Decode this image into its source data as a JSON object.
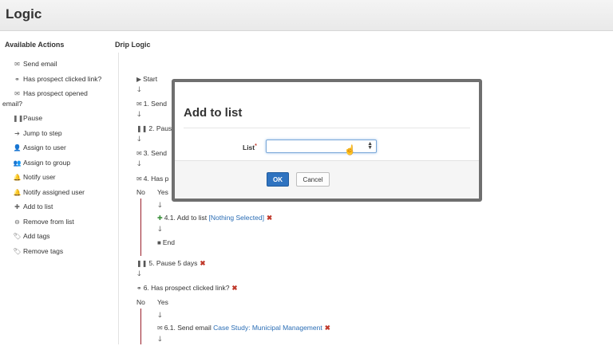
{
  "header": {
    "title": "Logic"
  },
  "available_actions": {
    "title": "Available Actions",
    "items": [
      {
        "label": "Send email",
        "icon": "envelope-icon",
        "glyph": "✉"
      },
      {
        "label": "Has prospect clicked link?",
        "icon": "link-icon",
        "glyph": "⚭"
      },
      {
        "label": "Has prospect opened",
        "label2": "email?",
        "icon": "envelope-open-icon",
        "glyph": "✉"
      },
      {
        "label": "Pause",
        "icon": "pause-icon",
        "glyph": "❚❚"
      },
      {
        "label": "Jump to step",
        "icon": "arrow-right-icon",
        "glyph": "➔"
      },
      {
        "label": "Assign to user",
        "icon": "user-icon",
        "glyph": "👤"
      },
      {
        "label": "Assign to group",
        "icon": "group-icon",
        "glyph": "👥"
      },
      {
        "label": "Notify user",
        "icon": "bell-icon",
        "glyph": "🔔"
      },
      {
        "label": "Notify assigned user",
        "icon": "bell-icon",
        "glyph": "🔔"
      },
      {
        "label": "Add to list",
        "icon": "plus-circle-icon",
        "glyph": "✚"
      },
      {
        "label": "Remove from list",
        "icon": "minus-circle-icon",
        "glyph": "⊖"
      },
      {
        "label": "Add tags",
        "icon": "tag-icon",
        "glyph": "🏷"
      },
      {
        "label": "Remove tags",
        "icon": "tag-remove-icon",
        "glyph": "🏷"
      }
    ]
  },
  "drip_logic": {
    "title": "Drip Logic",
    "start": "Start",
    "step1": "1. Send",
    "step2": "2. Pause",
    "step3": "3. Send",
    "step4": "4. Has p",
    "no": "No",
    "yes": "Yes",
    "step41": "4.1. Add to list",
    "step41_link": "[Nothing Selected]",
    "end": "End",
    "step5": "5. Pause 5 days",
    "step6": "6. Has prospect clicked link?",
    "no2": "No",
    "yes2": "Yes",
    "step61": "6.1. Send email",
    "step61_link": "Case Study: Municipal Management",
    "remove_glyph": "✖"
  },
  "modal": {
    "title": "Add to list",
    "field_label": "List",
    "required_mark": "*",
    "select_value": "",
    "ok_label": "OK",
    "cancel_label": "Cancel"
  },
  "colors": {
    "primary_button": "#2f73c0",
    "remove_x": "#c0392b",
    "link": "#2a6db5",
    "branch_line": "#9a1f2a"
  }
}
